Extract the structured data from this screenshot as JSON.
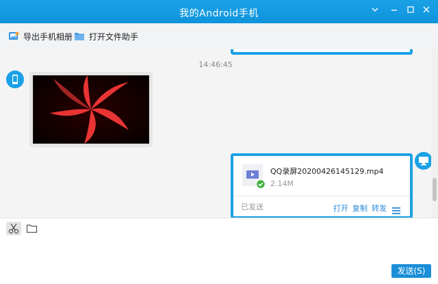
{
  "window": {
    "title": "我的Android手机",
    "colors": {
      "titlebar": "#1aa1e6",
      "accent": "#1aa1e6",
      "link": "#2a8ad8",
      "send": "#1a8fd8"
    },
    "controls": [
      "chevron-down-icon",
      "minimize-icon",
      "maximize-icon",
      "close-icon"
    ]
  },
  "toolbar": {
    "export_album": "导出手机相册",
    "open_file_helper": "打开文件助手"
  },
  "chat": {
    "timestamp": "14:46:45",
    "file_message": {
      "name": "QQ录屏20200426145129.mp4",
      "size": "2.14M",
      "status": "已发送",
      "actions": {
        "open": "打开",
        "copy": "复制",
        "forward": "转发"
      }
    }
  },
  "input": {
    "send_label": "发送(S)"
  }
}
